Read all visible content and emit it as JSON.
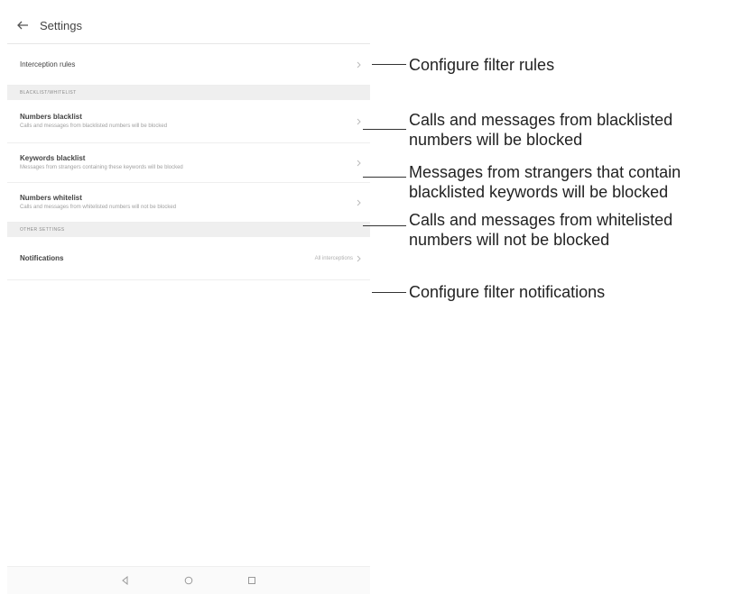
{
  "appbar": {
    "title": "Settings"
  },
  "rows": {
    "interception": {
      "title": "Interception rules"
    },
    "blacklist_header": "BLACKLIST/WHITELIST",
    "numbers_blacklist": {
      "title": "Numbers blacklist",
      "subtitle": "Calls and messages from blacklisted numbers will be blocked"
    },
    "keywords_blacklist": {
      "title": "Keywords blacklist",
      "subtitle": "Messages from strangers containing these keywords will be blocked"
    },
    "numbers_whitelist": {
      "title": "Numbers whitelist",
      "subtitle": "Calls and messages from whitelisted numbers will not be blocked"
    },
    "other_header": "OTHER SETTINGS",
    "notifications": {
      "title": "Notifications",
      "value": "All interceptions"
    }
  },
  "navbar": {
    "icons": [
      "back-triangle-icon",
      "home-circle-icon",
      "recents-square-icon"
    ]
  },
  "callouts": {
    "filter_rules": "Configure filter rules",
    "blacklist_line1": "Calls and messages from blacklisted",
    "blacklist_line2": "numbers will be blocked",
    "keywords_line1": "Messages from strangers that contain",
    "keywords_line2": "blacklisted keywords will be blocked",
    "whitelist_line1": "Calls and messages from whitelisted",
    "whitelist_line2": "numbers will not be blocked",
    "notifications": "Configure filter notifications"
  },
  "colors": {
    "section_bg": "#efefef",
    "callout_text": "#222222",
    "leader_line": "#333333"
  }
}
